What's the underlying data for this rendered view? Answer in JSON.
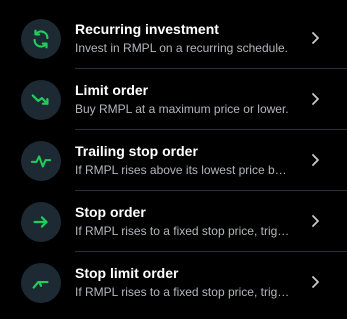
{
  "colors": {
    "accent": "#21ce5a",
    "icon_bg": "#1d2a33",
    "title": "#ffffff",
    "subtitle": "#b3b7ba"
  },
  "orders": [
    {
      "title": "Recurring investment",
      "subtitle": "Invest in RMPL on a recurring schedule.",
      "icon": "recurring-icon"
    },
    {
      "title": "Limit order",
      "subtitle": "Buy RMPL at a maximum price or lower.",
      "icon": "trend-down-icon"
    },
    {
      "title": "Trailing stop order",
      "subtitle": "If RMPL rises above its lowest price by ...",
      "icon": "pulse-icon"
    },
    {
      "title": "Stop order",
      "subtitle": "If RMPL rises to a fixed stop price, trigg...",
      "icon": "arrow-right-icon"
    },
    {
      "title": "Stop limit order",
      "subtitle": "If RMPL rises to a fixed stop price, trigg...",
      "icon": "stop-limit-icon"
    }
  ]
}
